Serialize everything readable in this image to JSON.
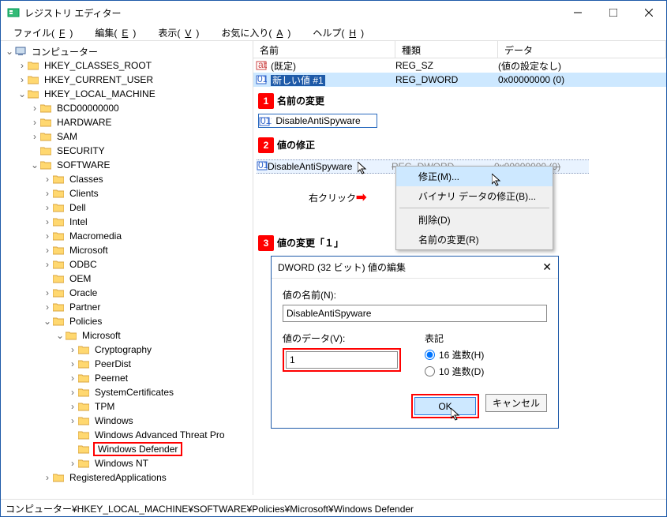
{
  "window": {
    "title": "レジストリ エディター"
  },
  "menu": {
    "file": "ファイル(",
    "file_u": "F",
    "edit": "編集(",
    "edit_u": "E",
    "view": "表示(",
    "view_u": "V",
    "fav": "お気に入り(",
    "fav_u": "A",
    "help": "ヘルプ(",
    "help_u": "H",
    "close": ")"
  },
  "tree": {
    "root": "コンピューター",
    "hkcr": "HKEY_CLASSES_ROOT",
    "hkcu": "HKEY_CURRENT_USER",
    "hklm": "HKEY_LOCAL_MACHINE",
    "bcd": "BCD00000000",
    "hardware": "HARDWARE",
    "sam": "SAM",
    "security": "SECURITY",
    "software": "SOFTWARE",
    "classes": "Classes",
    "clients": "Clients",
    "dell": "Dell",
    "intel": "Intel",
    "macromedia": "Macromedia",
    "microsoft": "Microsoft",
    "odbc": "ODBC",
    "oem": "OEM",
    "oracle": "Oracle",
    "partner": "Partner",
    "policies": "Policies",
    "pol_ms": "Microsoft",
    "crypt": "Cryptography",
    "peerdist": "PeerDist",
    "peernet": "Peernet",
    "syscert": "SystemCertificates",
    "tpm": "TPM",
    "windows": "Windows",
    "watp": "Windows Advanced Threat Pro",
    "wd": "Windows Defender",
    "wnt": "Windows NT",
    "regapp": "RegisteredApplications"
  },
  "list": {
    "cols": {
      "name": "名前",
      "type": "種類",
      "data": "データ"
    },
    "r1": {
      "name": "(既定)",
      "type": "REG_SZ",
      "data": "(値の設定なし)"
    },
    "r2": {
      "name": "新しい値 #1",
      "type": "REG_DWORD",
      "data": "0x00000000 (0)"
    },
    "anno1": "名前の変更",
    "rename": "DisableAntiSpyware",
    "anno2": "値の修正",
    "row3": {
      "name": "DisableAntiSpyware",
      "type": "REG_DWORD",
      "data": "0x00000000 (0)"
    },
    "rclick": "右クリック",
    "anno3": "値の変更「１」"
  },
  "ctx": {
    "modify": "修正(M)...",
    "modbin": "バイナリ データの修正(B)...",
    "del": "削除(D)",
    "rename": "名前の変更(R)"
  },
  "dlg": {
    "title": "DWORD (32 ビット) 値の編集",
    "name_lbl": "値の名前(N):",
    "name_val": "DisableAntiSpyware",
    "data_lbl": "値のデータ(V):",
    "data_val": "1",
    "radix_lbl": "表記",
    "hex": "16 進数(H)",
    "dec": "10 進数(D)",
    "ok": "OK",
    "cancel": "キャンセル"
  },
  "status": "コンピューター¥HKEY_LOCAL_MACHINE¥SOFTWARE¥Policies¥Microsoft¥Windows Defender"
}
